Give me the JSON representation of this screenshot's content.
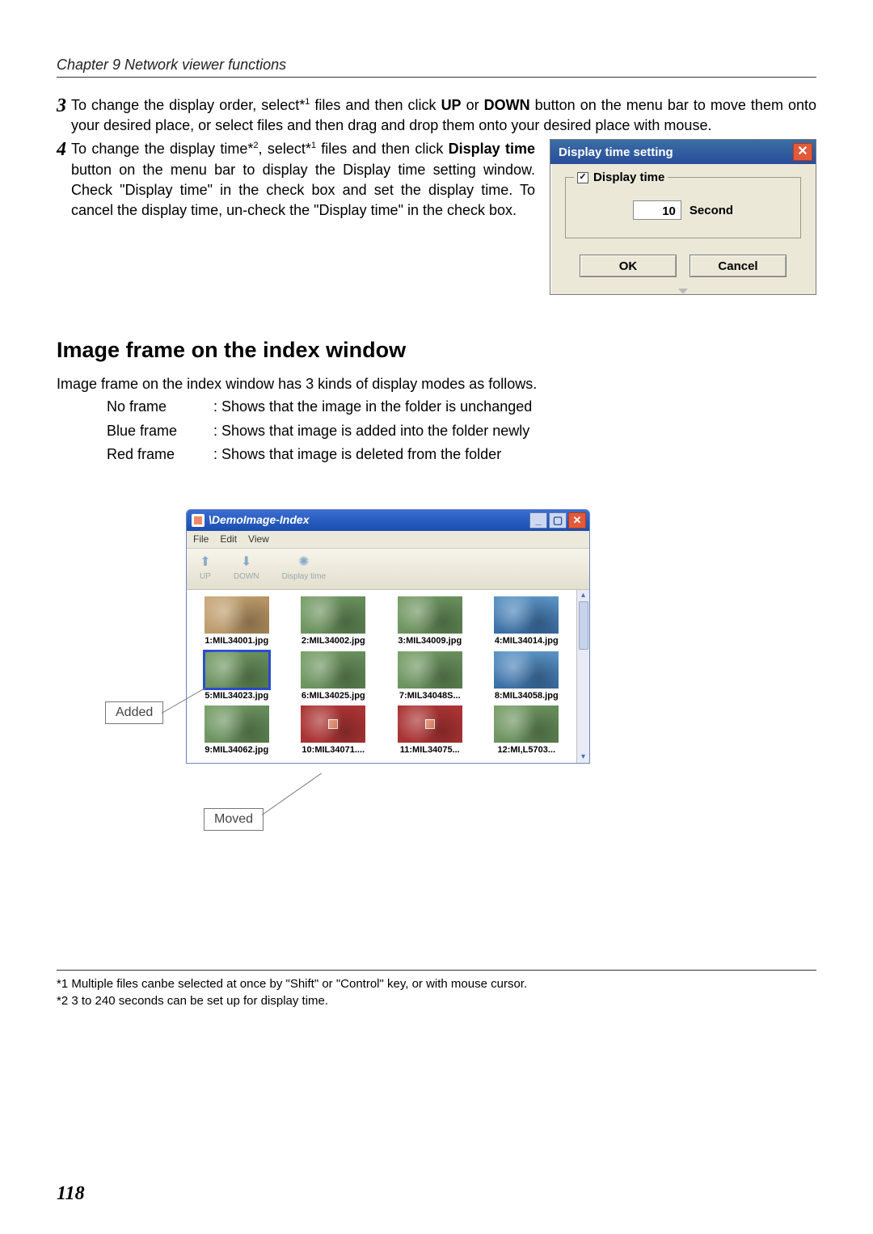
{
  "chapter": "Chapter 9 Network viewer functions",
  "step3": {
    "num": "3",
    "text_a": "To change the display order, select*",
    "sup_a": "1",
    "text_b": " files and then click ",
    "bold_up": "UP",
    "text_c": " or ",
    "bold_down": "DOWN",
    "text_d": " button on the menu bar to move them onto your desired place, or select files and then drag and drop them onto your desired place with mouse."
  },
  "step4": {
    "num": "4",
    "text_a": "To change the display time*",
    "sup_a": "2",
    "text_b": ", select*",
    "sup_b": "1",
    "text_c": " files and then click ",
    "bold_dt": "Display time",
    "text_d": " button on the menu bar to display the Display time setting window. Check \"Display time\" in the check box and set the display time. To cancel the display time, un-check the \"Display time\" in the check box."
  },
  "dialog_time": {
    "title": "Display time setting",
    "legend": "Display time",
    "value": "10",
    "unit": "Second",
    "ok": "OK",
    "cancel": "Cancel",
    "checkmark": "✓"
  },
  "section_title": "Image frame on the index window",
  "section_intro": "Image frame on the index window has 3 kinds of display modes as follows.",
  "frame_modes": {
    "r1_label": "No frame",
    "r1_desc": ": Shows that the image in the folder is unchanged",
    "r2_label": "Blue frame",
    "r2_desc": ": Shows that image is added into the folder newly",
    "r3_label": "Red frame",
    "r3_desc": ": Shows that image is deleted from the folder"
  },
  "demo": {
    "title": "\\DemoImage-Index",
    "menu_file": "File",
    "menu_edit": "Edit",
    "menu_view": "View",
    "tool_up": "UP",
    "tool_down": "DOWN",
    "tool_dt": "Display time",
    "thumbs": [
      "1:MIL34001.jpg",
      "2:MIL34002.jpg",
      "3:MIL34009.jpg",
      "4:MIL34014.jpg",
      "5:MIL34023.jpg",
      "6:MIL34025.jpg",
      "7:MIL34048S...",
      "8:MIL34058.jpg",
      "9:MIL34062.jpg",
      "10:MIL34071....",
      "11:MIL34075...",
      "12:MI,L5703..."
    ]
  },
  "callouts": {
    "added": "Added",
    "moved": "Moved"
  },
  "footnotes": {
    "f1": "*1 Multiple files canbe selected at once by \"Shift\" or \"Control\" key, or with mouse cursor.",
    "f2": "*2 3 to 240 seconds can be set up for display time."
  },
  "page_number": "118"
}
